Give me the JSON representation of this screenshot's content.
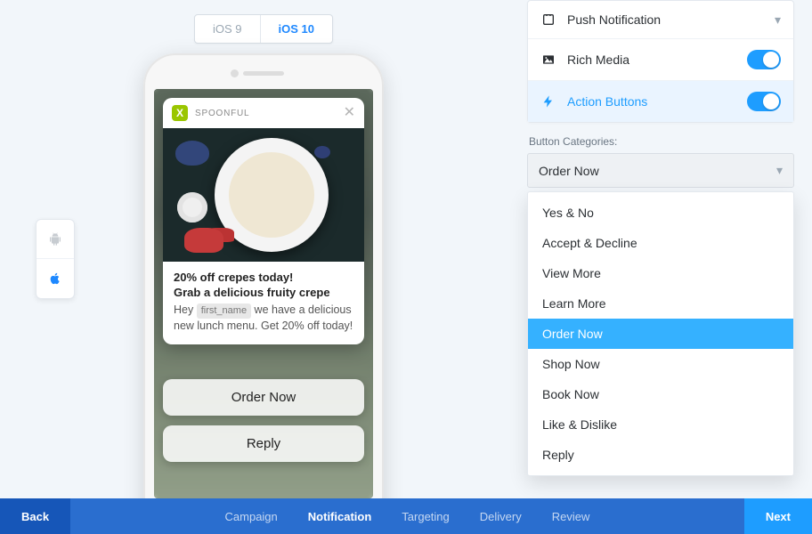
{
  "os_tabs": {
    "ios9": "iOS 9",
    "ios10": "iOS 10"
  },
  "notification": {
    "app_name": "SPOONFUL",
    "app_initial": "X",
    "title": "20% off crepes today!",
    "subtitle": "Grab a delicious fruity crepe",
    "body_pre": "Hey ",
    "token": "first_name",
    "body_post": " we have a delicious new lunch menu. Get 20% off today!",
    "action1": "Order Now",
    "action2": "Reply"
  },
  "settings": {
    "push_label": "Push Notification",
    "rich_media_label": "Rich Media",
    "action_buttons_label": "Action Buttons",
    "categories_label": "Button Categories:",
    "selected_category": "Order Now",
    "options": [
      "Yes & No",
      "Accept & Decline",
      "View More",
      "Learn More",
      "Order Now",
      "Shop Now",
      "Book Now",
      "Like & Dislike",
      "Reply"
    ]
  },
  "footer": {
    "back": "Back",
    "next": "Next",
    "steps": [
      "Campaign",
      "Notification",
      "Targeting",
      "Delivery",
      "Review"
    ],
    "active_index": 1
  }
}
